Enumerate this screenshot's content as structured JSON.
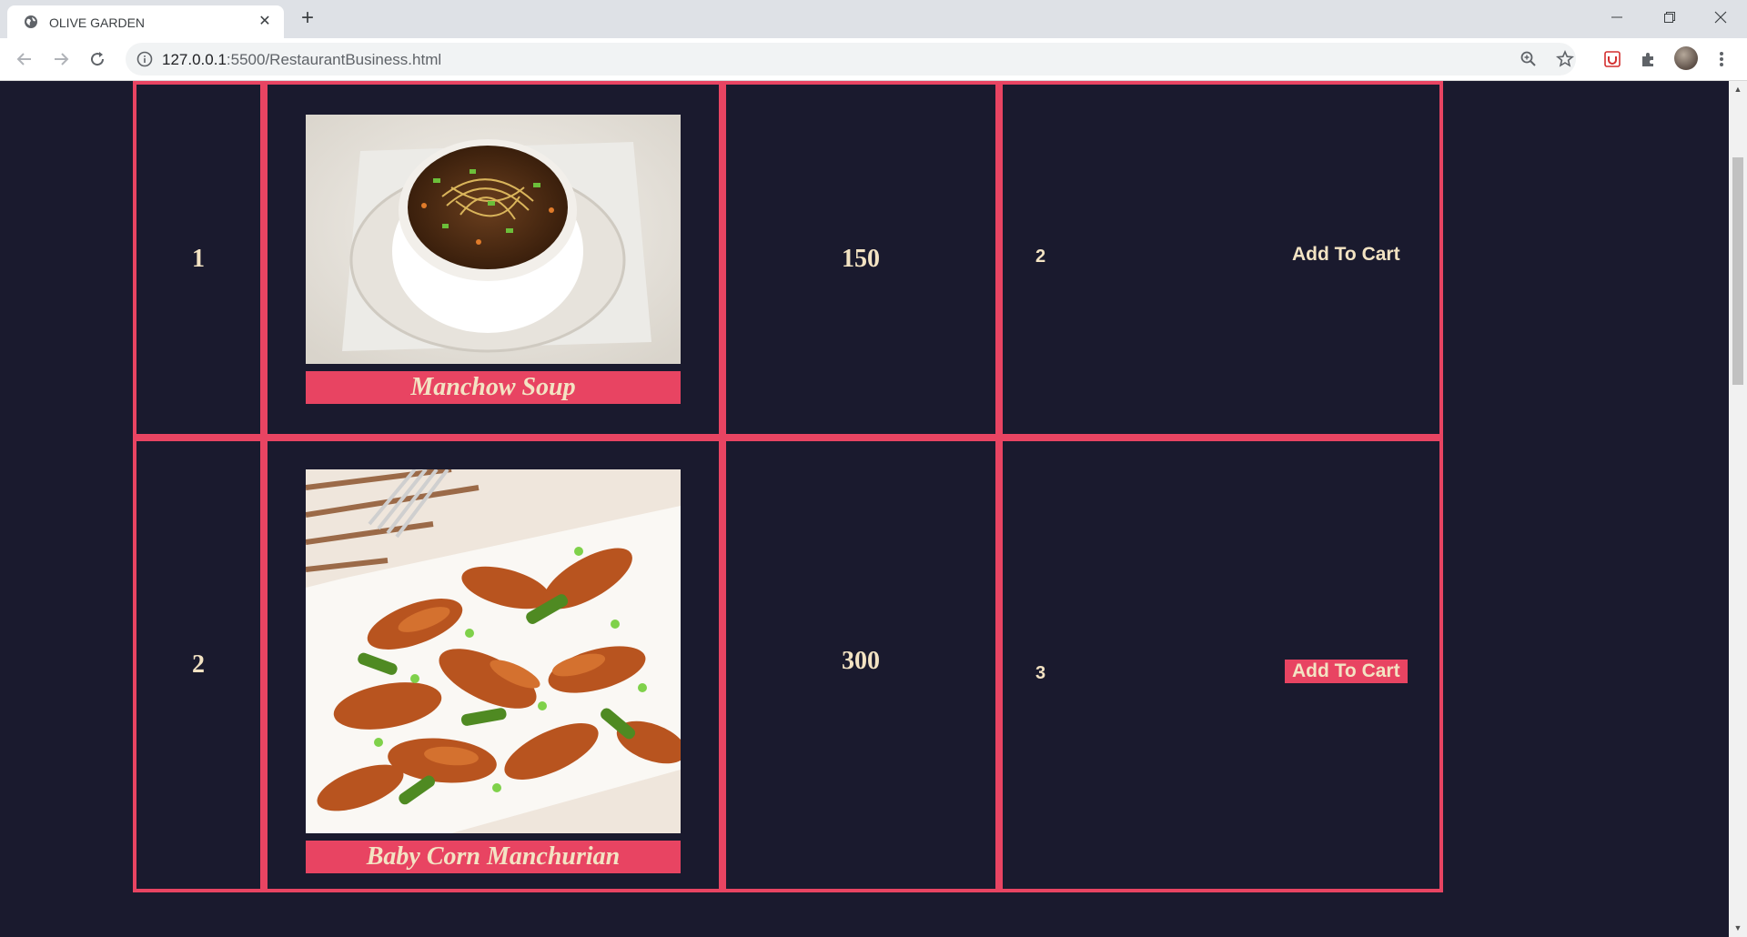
{
  "browser": {
    "tab_title": "OLIVE GARDEN",
    "url_host": "127.0.0.1",
    "url_rest": ":5500/RestaurantBusiness.html"
  },
  "menu": {
    "rows": [
      {
        "sno": "1",
        "item_name": "Manchow Soup",
        "price": "150",
        "quantity": "2",
        "cart_label": "Add To Cart",
        "cart_highlighted": false
      },
      {
        "sno": "2",
        "item_name": "Baby Corn Manchurian",
        "price": "300",
        "quantity": "3",
        "cart_label": "Add To Cart",
        "cart_highlighted": true
      }
    ]
  },
  "colors": {
    "page_background": "#1a1a2e",
    "border_accent": "#e84462",
    "text": "#f3e3c3"
  }
}
